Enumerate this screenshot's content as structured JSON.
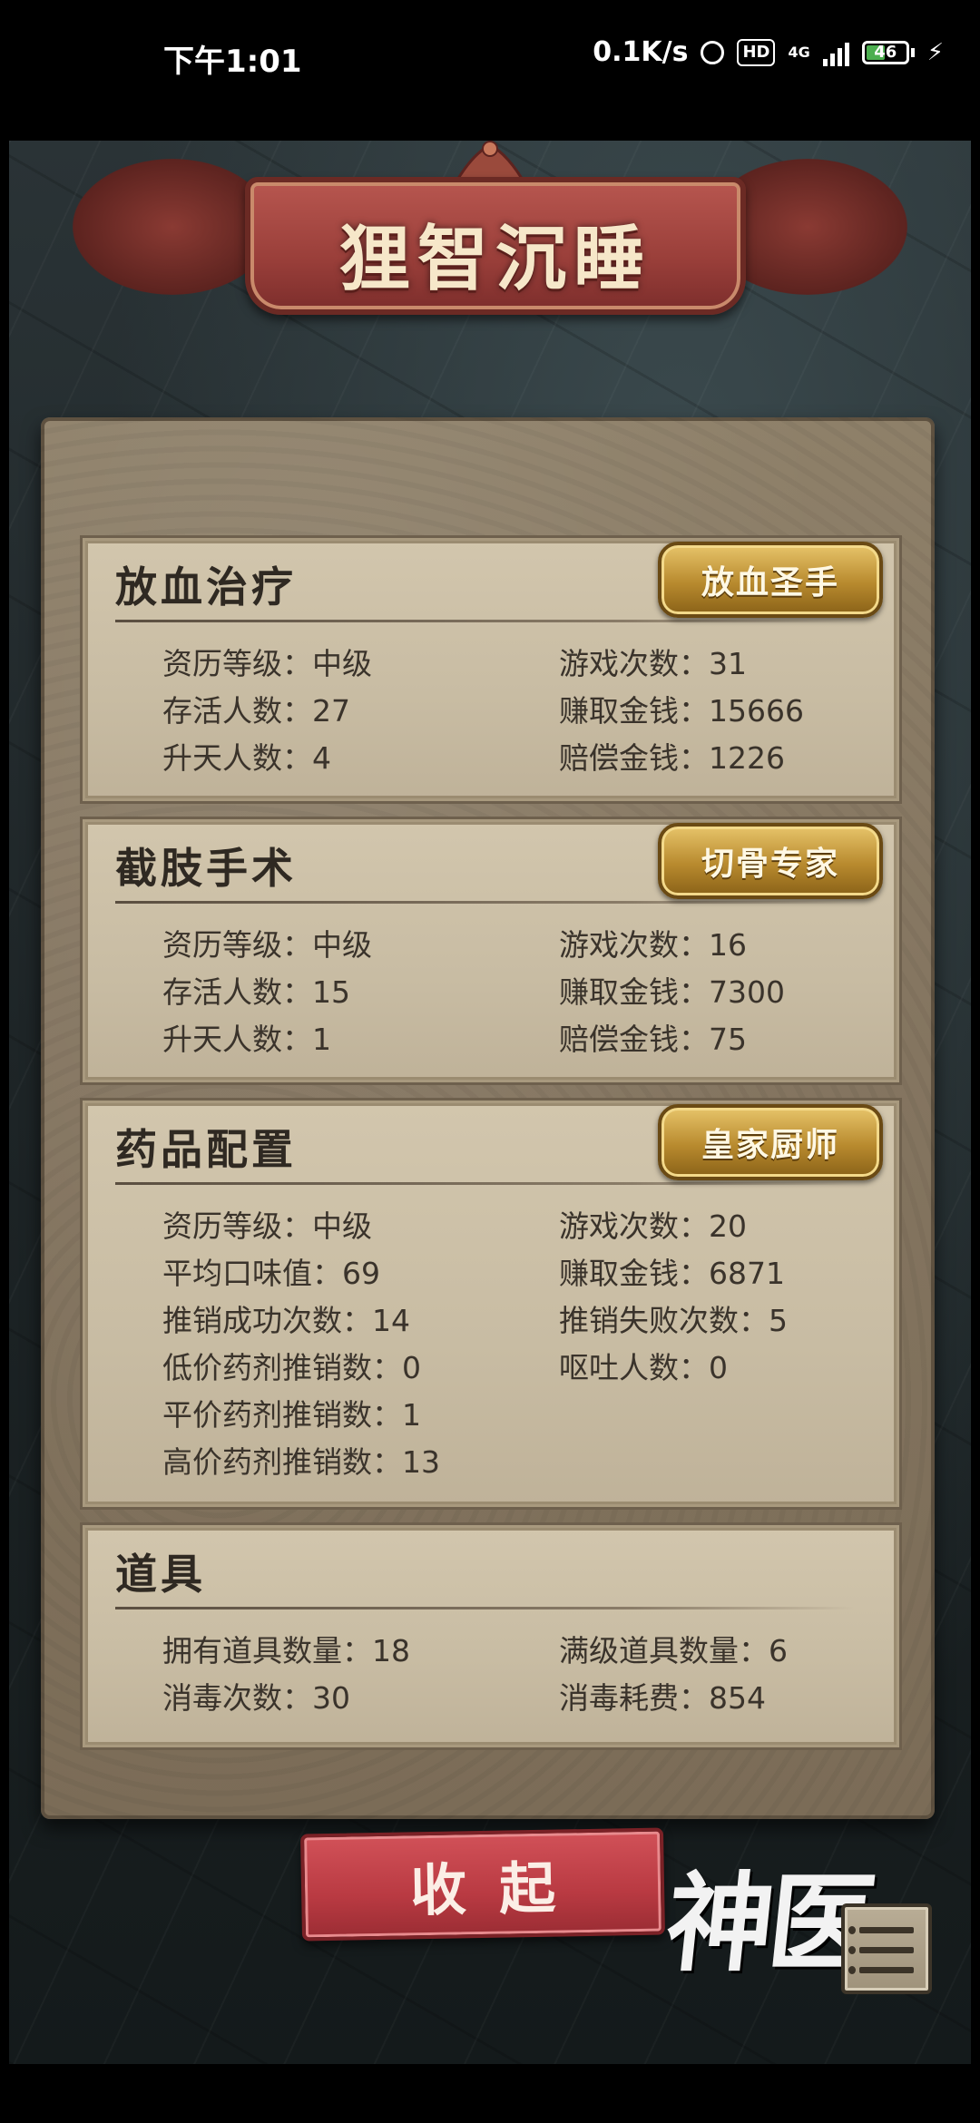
{
  "status_bar": {
    "time": "下午1:01",
    "speed": "0.1K/s",
    "hd": "HD",
    "network": "4G",
    "battery": "46",
    "battery_level": 0.46
  },
  "title": "狸智沉睡",
  "sections": [
    {
      "title": "放血治疗",
      "badge": "放血圣手",
      "stats_left": [
        "资历等级：中级",
        "存活人数：27",
        "升天人数：4"
      ],
      "stats_right": [
        "游戏次数：31",
        "赚取金钱：15666",
        "赔偿金钱：1226"
      ]
    },
    {
      "title": "截肢手术",
      "badge": "切骨专家",
      "stats_left": [
        "资历等级：中级",
        "存活人数：15",
        "升天人数：1"
      ],
      "stats_right": [
        "游戏次数：16",
        "赚取金钱：7300",
        "赔偿金钱：75"
      ]
    },
    {
      "title": "药品配置",
      "badge": "皇家厨师",
      "stats_left": [
        "资历等级：中级",
        "平均口味值：69",
        "推销成功次数：14",
        "低价药剂推销数：0",
        "平价药剂推销数：1",
        "高价药剂推销数：13"
      ],
      "stats_right": [
        "游戏次数：20",
        "赚取金钱：6871",
        "推销失败次数：5",
        "呕吐人数：0"
      ]
    },
    {
      "title": "道具",
      "stats_left": [
        "拥有道具数量：18",
        "消毒次数：30"
      ],
      "stats_right": [
        "满级道具数量：6",
        "消毒耗费：854"
      ]
    }
  ],
  "collapse_button": "收起",
  "logo_text": "神医",
  "icons": {
    "alarm": "alarm-icon",
    "signal": "signal-icon",
    "battery": "battery-icon",
    "charging": "bolt-icon",
    "menu": "list-menu-icon"
  },
  "colors": {
    "banner": "#9a3f3a",
    "badge_gold": "#b88a2e",
    "button_red": "#b93a42",
    "parchment": "#c8bca3"
  }
}
